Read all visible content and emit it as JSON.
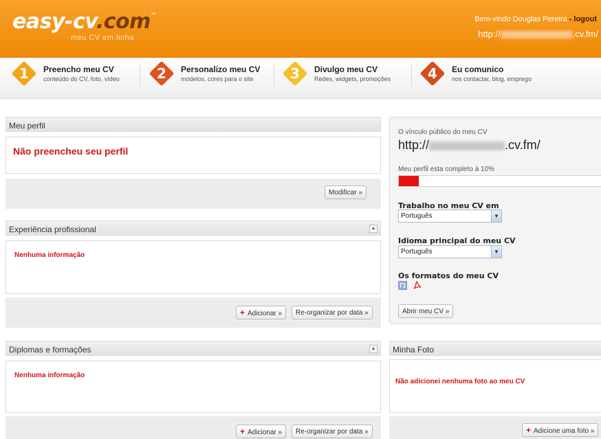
{
  "header": {
    "logo_main": "easy-cv",
    "logo_dot": ".com",
    "logo_tm": "™",
    "tagline": "meu CV em linha",
    "welcome_text": "Bem-vindo Douglas Pereira",
    "logout_label": "- logout",
    "public_url_prefix": "http://",
    "public_url_suffix": ".cv.fm/"
  },
  "steps": [
    {
      "number": "1",
      "title": "Preencho meu CV",
      "subtitle": "conteúdo do CV, foto, vídeo",
      "color": "#f5a31a"
    },
    {
      "number": "2",
      "title": "Personalizo meu CV",
      "subtitle": "modelos, cores para o site",
      "color": "#e0521f"
    },
    {
      "number": "3",
      "title": "Divulgo meu CV",
      "subtitle": "Redes, widgets, promoções",
      "color": "#f6c02a"
    },
    {
      "number": "4",
      "title": "Eu comunico",
      "subtitle": "nos contactar, blog, emprego",
      "color": "#d84d1e"
    }
  ],
  "profile": {
    "title": "Meu perfil",
    "message": "Não preencheu seu perfil",
    "modify_label": "Modificar »"
  },
  "experience": {
    "title": "Experiência profissional",
    "empty": "Nenhuma informação",
    "add_label": "Adicionar »",
    "reorder_label": "Re-organizar por data »"
  },
  "diplomas": {
    "title": "Diplomas e formações",
    "empty": "Nenhuma informação",
    "add_label": "Adicionar »",
    "reorder_label": "Re-organizar por data »"
  },
  "sidebar": {
    "public_link_label": "O vínculo público do meu CV",
    "url_prefix": "http://",
    "url_suffix": ".cv.fm/",
    "completion_label": "Meu perfil esta completo à 10%",
    "completion_value": 0.1,
    "work_lang_label": "Trabalho no meu CV em",
    "work_lang_value": "Português",
    "main_lang_label": "Idioma principal do meu CV",
    "main_lang_value": "Português",
    "formats_label": "Os formatos do meu CV",
    "open_cv_label": "Abrir meu CV »"
  },
  "photo": {
    "title": "Minha Foto",
    "message": "Não adicionei nenhuma foto ao meu CV",
    "add_label": "Adicione uma foto »"
  },
  "colors": {
    "header_orange": "#f08a06",
    "alert_red": "#d11616"
  }
}
